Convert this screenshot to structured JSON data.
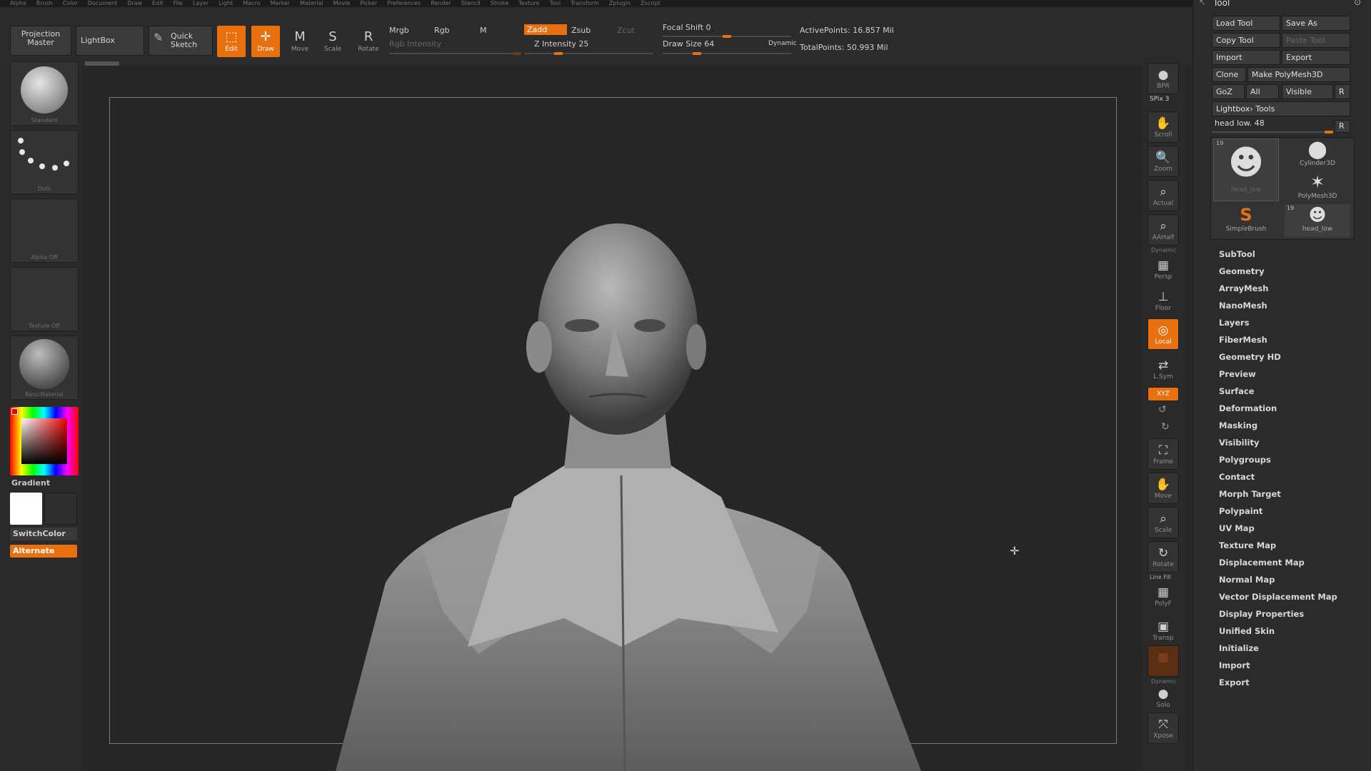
{
  "menu": [
    "Alpha",
    "Brush",
    "Color",
    "Document",
    "Draw",
    "Edit",
    "File",
    "Layer",
    "Light",
    "Macro",
    "Marker",
    "Material",
    "Movie",
    "Picker",
    "Preferences",
    "Render",
    "Stencil",
    "Stroke",
    "Texture",
    "Tool",
    "Transform",
    "Zplugin",
    "Zscript"
  ],
  "shelf": {
    "projection_master": "Projection Master",
    "lightbox": "LightBox",
    "quick_sketch": "Quick Sketch",
    "tools": [
      {
        "label": "Edit",
        "glyph": "⬚",
        "active": true
      },
      {
        "label": "Draw",
        "glyph": "✛",
        "active": true
      },
      {
        "label": "Move",
        "glyph": "M",
        "active": false
      },
      {
        "label": "Scale",
        "glyph": "S",
        "active": false
      },
      {
        "label": "Rotate",
        "glyph": "R",
        "active": false
      }
    ],
    "mrgb": "Mrgb",
    "rgb": "Rgb",
    "m": "M",
    "rgb_intensity": "Rgb Intensity",
    "zadd": "Zadd",
    "zsub": "Zsub",
    "zcut": "Zcut",
    "z_intensity": "Z Intensity 25",
    "z_intensity_value": 25,
    "focal_shift": "Focal Shift 0",
    "draw_size": "Draw Size 64",
    "dynamic": "Dynamic",
    "active_points": "ActivePoints: 16.857 Mil",
    "total_points": "TotalPoints: 50.993 Mil"
  },
  "left": {
    "brush_label": "Standard",
    "stroke_label": "Dots",
    "alpha_label": "Alpha Off",
    "texture_label": "Texture Off",
    "material_label": "BasicMaterial",
    "gradient": "Gradient",
    "switch_color": "SwitchColor",
    "alternate": "Alternate",
    "colors": {
      "main": "#ffffff",
      "secondary": "#2e2e2e",
      "accent": "#e8700f"
    }
  },
  "right": {
    "spix": "SPix 3",
    "icons": [
      {
        "name": "bpr",
        "label": "BPR",
        "glyph": "●",
        "active": false
      },
      {
        "name": "scroll",
        "label": "Scroll",
        "glyph": "✋",
        "active": false
      },
      {
        "name": "zoom",
        "label": "Zoom",
        "glyph": "🔍",
        "active": false
      },
      {
        "name": "actual",
        "label": "Actual",
        "glyph": "⌕",
        "active": false
      },
      {
        "name": "aahalf",
        "label": "AAHalf",
        "glyph": "⌕",
        "active": false
      },
      {
        "name": "persp",
        "label": "Persp",
        "glyph": "▦",
        "active": false
      },
      {
        "name": "floor",
        "label": "Floor",
        "glyph": "⊥",
        "active": false
      },
      {
        "name": "local",
        "label": "Local",
        "glyph": "◎",
        "active": true
      },
      {
        "name": "lsym",
        "label": "L.Sym",
        "glyph": "⇄",
        "active": false
      },
      {
        "name": "xyz",
        "label": "XYZ",
        "glyph": "⟲",
        "active": true
      },
      {
        "name": "frame",
        "label": "Frame",
        "glyph": "⛶",
        "active": false
      },
      {
        "name": "move",
        "label": "Move",
        "glyph": "✋",
        "active": false
      },
      {
        "name": "scale",
        "label": "Scale",
        "glyph": "⌕",
        "active": false
      },
      {
        "name": "rotate",
        "label": "Rotate",
        "glyph": "↻",
        "active": false
      },
      {
        "name": "polyf",
        "label": "PolyF",
        "glyph": "▦",
        "active": false
      },
      {
        "name": "transp",
        "label": "Transp",
        "glyph": "▣",
        "active": false
      },
      {
        "name": "ghost",
        "label": "",
        "glyph": "■",
        "active": false
      },
      {
        "name": "solo",
        "label": "Solo",
        "glyph": "●",
        "active": false
      },
      {
        "name": "xpose",
        "label": "Xpose",
        "glyph": "⤧",
        "active": false
      }
    ],
    "dynamic": "Dynamic",
    "line_fill": "Line Fill"
  },
  "palette": {
    "title": "Tool",
    "load_tool": "Load Tool",
    "save_as": "Save As",
    "copy_tool": "Copy Tool",
    "paste_tool": "Paste Tool",
    "import": "Import",
    "export": "Export",
    "clone": "Clone",
    "make_polymesh": "Make PolyMesh3D",
    "goz": "GoZ",
    "all": "All",
    "visible": "Visible",
    "r": "R",
    "lightbox_tools": "Lightbox› Tools",
    "current_tool": "head low. 48",
    "thumbs": [
      {
        "label": "head_low",
        "glyph": "☻",
        "count": "19"
      },
      {
        "label": "Cylinder3D",
        "glyph": "⬤",
        "count": ""
      },
      {
        "label": "PolyMesh3D",
        "glyph": "✶",
        "count": ""
      },
      {
        "label": "SimpleBrush",
        "glyph": "S",
        "count": ""
      },
      {
        "label": "head_low",
        "glyph": "☻",
        "count": "19"
      }
    ],
    "sections": [
      "SubTool",
      "Geometry",
      "ArrayMesh",
      "NanoMesh",
      "Layers",
      "FiberMesh",
      "Geometry HD",
      "Preview",
      "Surface",
      "Deformation",
      "Masking",
      "Visibility",
      "Polygroups",
      "Contact",
      "Morph Target",
      "Polypaint",
      "UV Map",
      "Texture Map",
      "Displacement Map",
      "Normal Map",
      "Vector Displacement Map",
      "Display Properties",
      "Unified Skin",
      "Initialize",
      "Import",
      "Export"
    ]
  }
}
